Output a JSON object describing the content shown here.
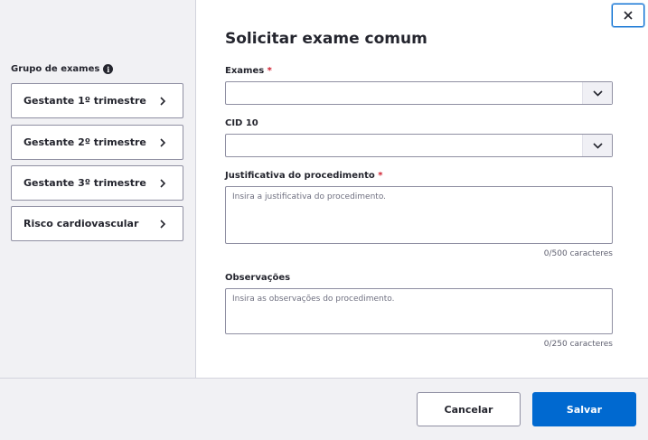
{
  "dialog": {
    "title": "Solicitar exame comum",
    "close_icon": "close-icon"
  },
  "groups": {
    "title": "Grupo de exames",
    "info_icon": "info-icon",
    "items": [
      {
        "label": "Gestante 1º trimestre"
      },
      {
        "label": "Gestante 2º trimestre"
      },
      {
        "label": "Gestante 3º trimestre"
      },
      {
        "label": "Risco cardiovascular"
      }
    ]
  },
  "form": {
    "exames": {
      "label": "Exames",
      "required_mark": "*",
      "value": ""
    },
    "cid10": {
      "label": "CID 10",
      "value": ""
    },
    "justificativa": {
      "label": "Justificativa do procedimento",
      "required_mark": "*",
      "placeholder": "Insira a justificativa do procedimento.",
      "counter": "0/500 caracteres"
    },
    "observacoes": {
      "label": "Observações",
      "placeholder": "Insira as observações do procedimento.",
      "counter": "0/250 caracteres"
    }
  },
  "footer": {
    "cancel_label": "Cancelar",
    "save_label": "Salvar"
  },
  "colors": {
    "primary": "#0069d0",
    "required": "#d01e2f",
    "panel_bg": "#f1f1f4"
  }
}
